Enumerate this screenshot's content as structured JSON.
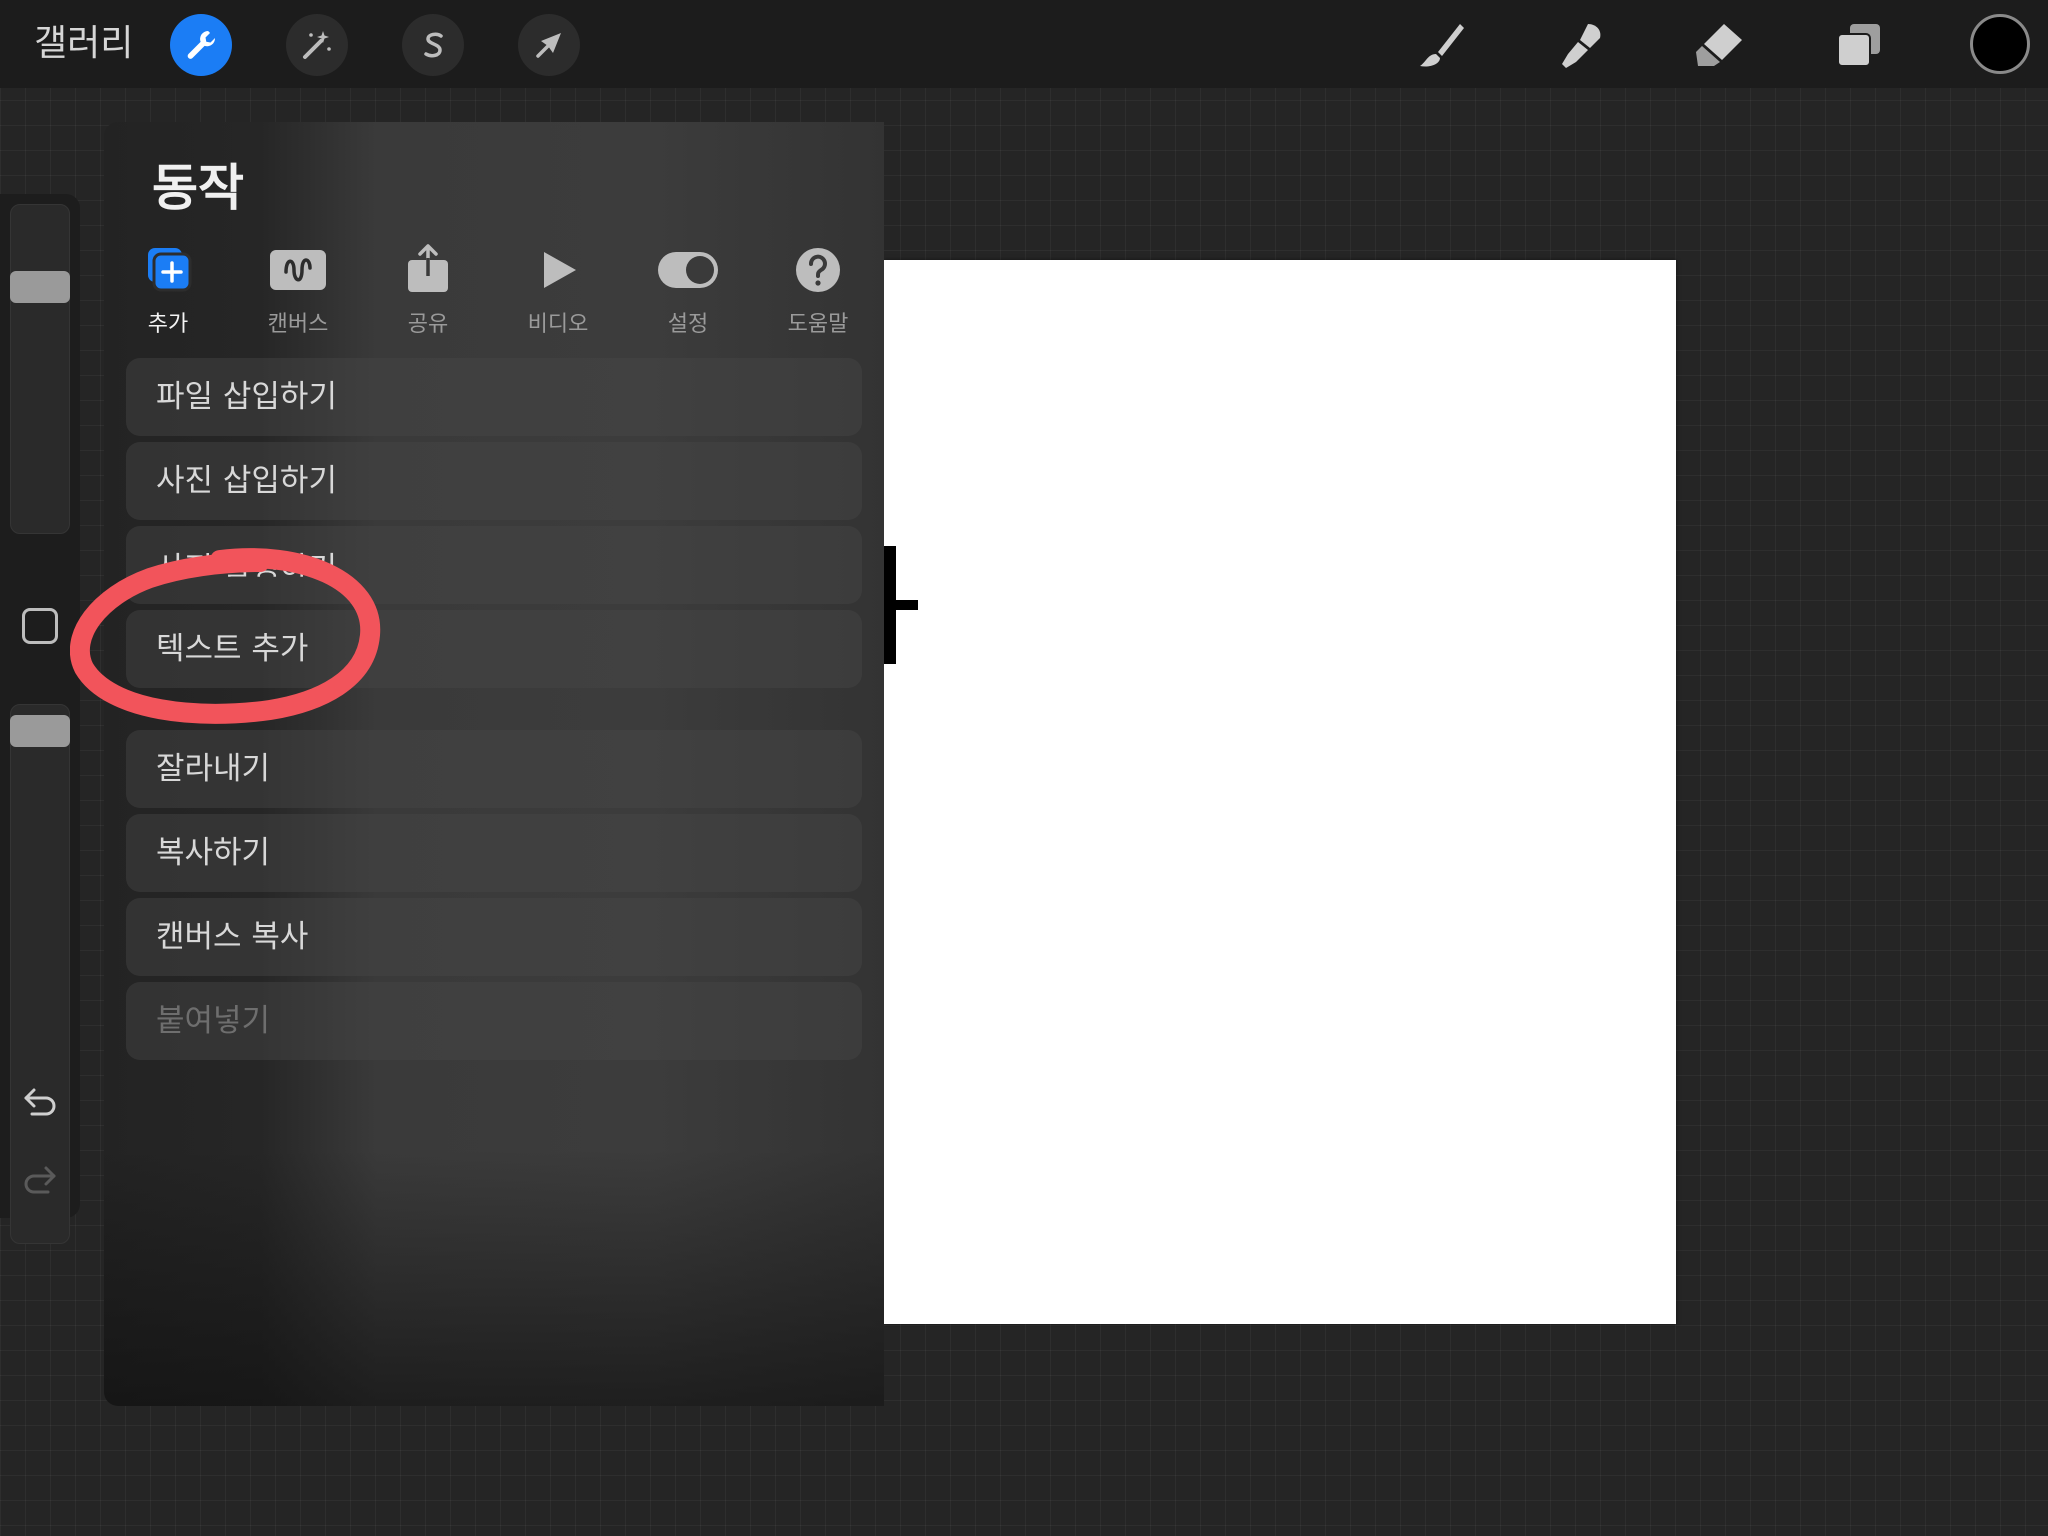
{
  "topbar": {
    "gallery_label": "갤러리",
    "tool_icons": [
      "wrench-icon",
      "magic-wand-icon",
      "selection-icon",
      "transform-arrow-icon"
    ],
    "right_tools": [
      "brush-icon",
      "smudge-icon",
      "eraser-icon",
      "layers-icon"
    ],
    "current_color": "#000000",
    "accent": "#1b7df5"
  },
  "panel": {
    "title": "동작",
    "tabs": [
      {
        "label": "추가",
        "icon": "add-icon",
        "active": true
      },
      {
        "label": "캔버스",
        "icon": "canvas-icon",
        "active": false
      },
      {
        "label": "공유",
        "icon": "share-icon",
        "active": false
      },
      {
        "label": "비디오",
        "icon": "play-icon",
        "active": false
      },
      {
        "label": "설정",
        "icon": "toggle-icon",
        "active": false
      },
      {
        "label": "도움말",
        "icon": "help-icon",
        "active": false
      }
    ],
    "items": [
      {
        "label": "파일 삽입하기",
        "enabled": true
      },
      {
        "label": "사진 삽입하기",
        "enabled": true
      },
      {
        "label": "사진 촬영하기",
        "enabled": true
      },
      {
        "label": "텍스트 추가",
        "enabled": true
      },
      {
        "label": "잘라내기",
        "enabled": true
      },
      {
        "label": "복사하기",
        "enabled": true
      },
      {
        "label": "캔버스 복사",
        "enabled": true
      },
      {
        "label": "붙여넣기",
        "enabled": false
      }
    ]
  },
  "sidebar": {
    "brush_size_level": 0.22,
    "opacity_level": 0.02
  },
  "annotation": {
    "color": "#f2545b"
  }
}
